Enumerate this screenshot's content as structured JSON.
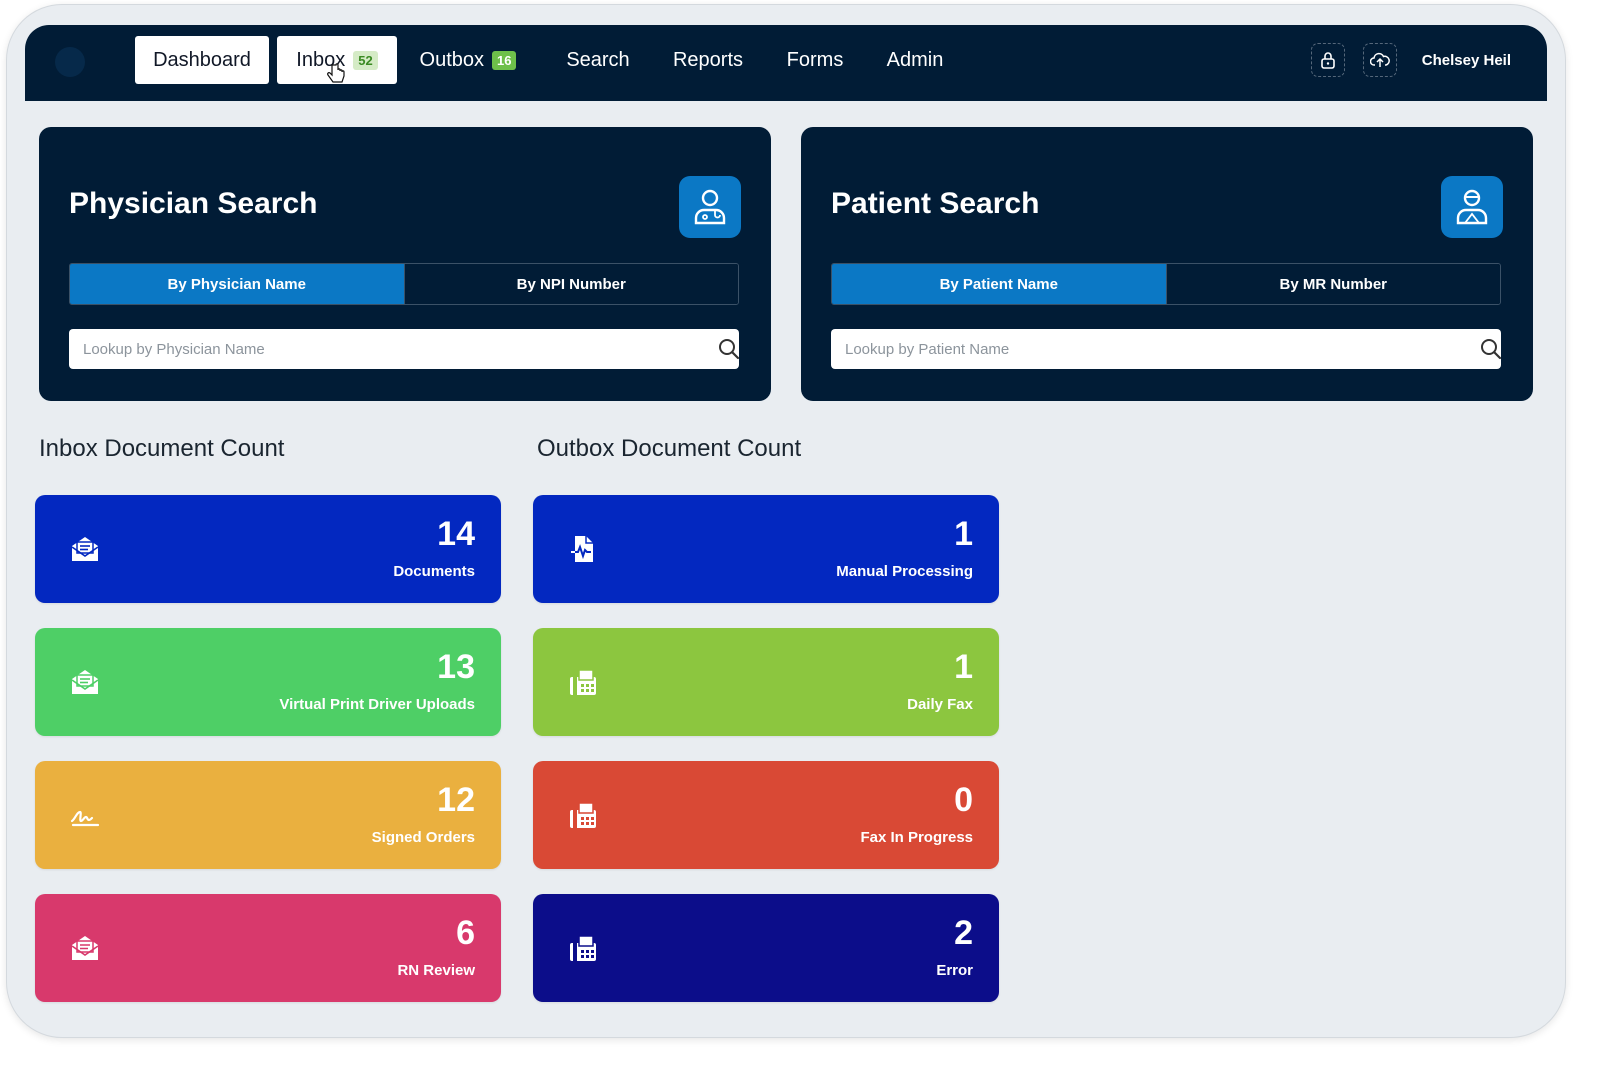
{
  "navbar": {
    "items": [
      {
        "label": "Dashboard",
        "active": true
      },
      {
        "label": "Inbox",
        "badge": "52",
        "active": true
      },
      {
        "label": "Outbox",
        "badge": "16"
      },
      {
        "label": "Search"
      },
      {
        "label": "Reports"
      },
      {
        "label": "Forms"
      },
      {
        "label": "Admin"
      }
    ],
    "user_name": "Chelsey Heil",
    "icons": [
      "lock-icon",
      "cloud-upload-icon"
    ]
  },
  "physician_search": {
    "title": "Physician Search",
    "icon": "physician-icon",
    "tabs": [
      "By Physician Name",
      "By NPI Number"
    ],
    "active_tab": "By Physician Name",
    "placeholder": "Lookup by Physician Name"
  },
  "patient_search": {
    "title": "Patient Search",
    "icon": "patient-icon",
    "tabs": [
      "By Patient Name",
      "By MR Number"
    ],
    "active_tab": "By Patient Name",
    "placeholder": "Lookup by Patient Name"
  },
  "inbox": {
    "title": "Inbox Document Count",
    "tiles": [
      {
        "count": "14",
        "label": "Documents",
        "color": "#0328c0",
        "icon": "envelope-open-icon"
      },
      {
        "count": "13",
        "label": "Virtual Print Driver Uploads",
        "color": "#4ecf66",
        "icon": "envelope-open-icon"
      },
      {
        "count": "12",
        "label": "Signed Orders",
        "color": "#eab03f",
        "icon": "signature-icon"
      },
      {
        "count": "6",
        "label": "RN Review",
        "color": "#d8396c",
        "icon": "envelope-open-icon"
      }
    ]
  },
  "outbox": {
    "title": "Outbox Document Count",
    "tiles": [
      {
        "count": "1",
        "label": "Manual Processing",
        "color": "#0328c0",
        "icon": "document-pulse-icon"
      },
      {
        "count": "1",
        "label": "Daily Fax",
        "color": "#8cc63f",
        "icon": "fax-icon"
      },
      {
        "count": "0",
        "label": "Fax In Progress",
        "color": "#d94935",
        "icon": "fax-icon"
      },
      {
        "count": "2",
        "label": "Error",
        "color": "#0c0d8a",
        "icon": "fax-icon"
      }
    ]
  }
}
